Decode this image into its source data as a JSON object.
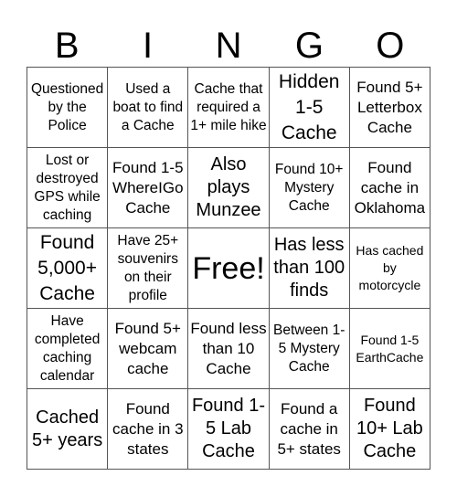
{
  "header": [
    "B",
    "I",
    "N",
    "G",
    "O"
  ],
  "cells": [
    "Questioned by the Police",
    "Used a boat to find a Cache",
    "Cache that required a 1+ mile hike",
    "Hidden 1-5 Cache",
    "Found 5+ Letterbox Cache",
    "Lost or destroyed GPS while caching",
    "Found 1-5 WhereIGo Cache",
    "Also plays Munzee",
    "Found 10+ Mystery Cache",
    "Found cache in Oklahoma",
    "Found 5,000+ Cache",
    "Have 25+ souvenirs on their profile",
    "Free!",
    "Has less than 100 finds",
    "Has cached by motorcycle",
    "Have completed caching calendar",
    "Found 5+ webcam cache",
    "Found less than 10 Cache",
    "Between 1-5 Mystery Cache",
    "Found 1-5 EarthCache",
    "Cached 5+ years",
    "Found cache in 3 states",
    "Found 1-5 Lab Cache",
    "Found a cache in 5+ states",
    "Found 10+ Lab Cache"
  ]
}
